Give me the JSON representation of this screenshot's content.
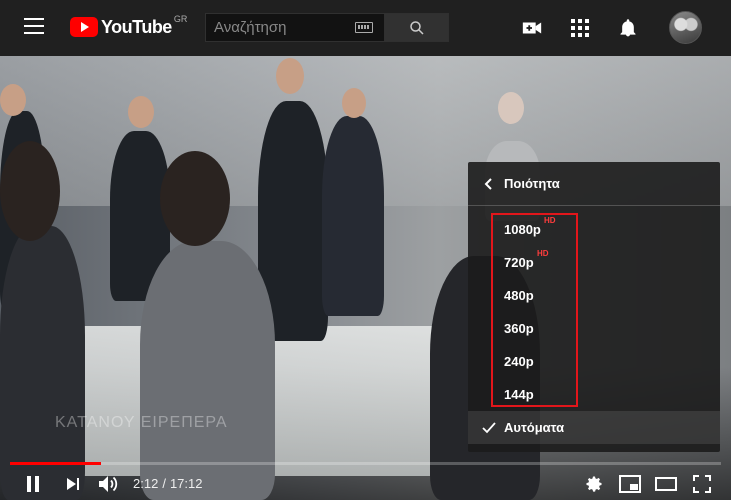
{
  "header": {
    "logo_text": "YouTube",
    "region": "GR",
    "search_placeholder": "Αναζήτηση"
  },
  "icons": {
    "menu": "hamburger-icon",
    "keyboard": "keyboard-icon",
    "search": "search-icon",
    "create": "video-create-icon",
    "apps": "apps-grid-icon",
    "notifications": "bell-icon",
    "avatar": "account-avatar"
  },
  "video": {
    "watermark": "ΚΑΤΑΝΟΥ ΕΙΡΕΠΕΡΑ"
  },
  "quality_menu": {
    "title": "Ποιότητα",
    "options": [
      {
        "label": "1080p",
        "badge": "HD"
      },
      {
        "label": "720p",
        "badge": "HD"
      },
      {
        "label": "480p",
        "badge": ""
      },
      {
        "label": "360p",
        "badge": ""
      },
      {
        "label": "240p",
        "badge": ""
      },
      {
        "label": "144p",
        "badge": ""
      }
    ],
    "selected": "Αυτόματα"
  },
  "player": {
    "current_time": "2:12",
    "separator": "/",
    "duration": "17:12",
    "progress_fraction": 0.128
  },
  "colors": {
    "brand_red": "#ff0000",
    "highlight_box": "#e2161b",
    "header_bg": "#202020"
  }
}
